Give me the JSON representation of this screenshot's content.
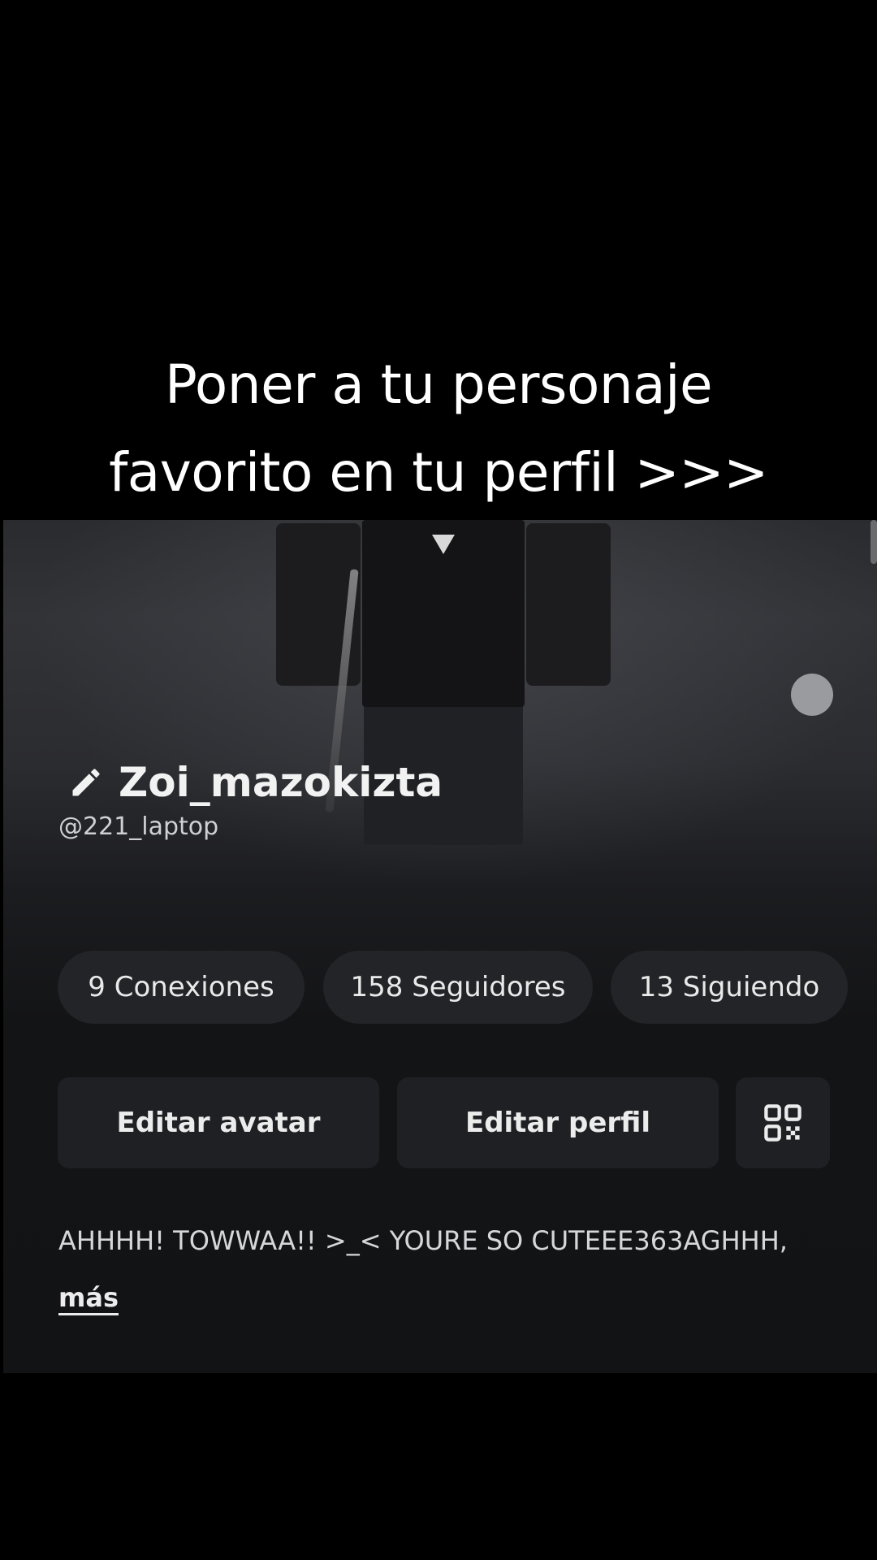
{
  "caption": {
    "line1": "Poner a tu personaje",
    "line2": "favorito en tu perfil >>>"
  },
  "profile": {
    "display_name": "Zoi_mazokizta",
    "username": "@221_laptop",
    "stats": {
      "connections": "9 Conexiones",
      "followers": "158 Seguidores",
      "following": "13 Siguiendo"
    },
    "buttons": {
      "edit_avatar": "Editar avatar",
      "edit_profile": "Editar perfil"
    },
    "bio": "AHHHH! TOWWAA!! >_< YOURE SO CUTEEE363AGHHH,",
    "more_label": "más"
  },
  "icons": {
    "edit": "pencil-icon",
    "qr": "qr-code-icon"
  },
  "colors": {
    "page_background": "#000000",
    "panel_background": "#121315",
    "chip_background": "#232427",
    "button_background": "#1f2023",
    "text_primary": "#ffffff"
  }
}
